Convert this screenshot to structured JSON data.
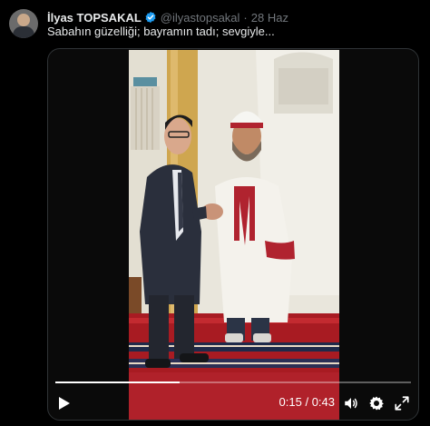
{
  "author": {
    "name": "İlyas TOPSAKAL",
    "handle": "@ilyastopsakal",
    "separator": "·",
    "date": "28 Haz"
  },
  "tweet": {
    "text": "Sabahın güzelliği; bayramın tadı; sevgiyle..."
  },
  "video": {
    "current_time": "0:15",
    "duration": "0:43",
    "time_separator": " / ",
    "progress_fraction": 0.349
  },
  "icons": {
    "verified": "verified-badge-icon",
    "play": "play-icon",
    "volume": "volume-icon",
    "settings": "gear-icon",
    "fullscreen": "fullscreen-icon"
  },
  "colors": {
    "background": "#000000",
    "text": "#e7e9ea",
    "muted": "#71767b",
    "verified": "#1d9bf0"
  }
}
